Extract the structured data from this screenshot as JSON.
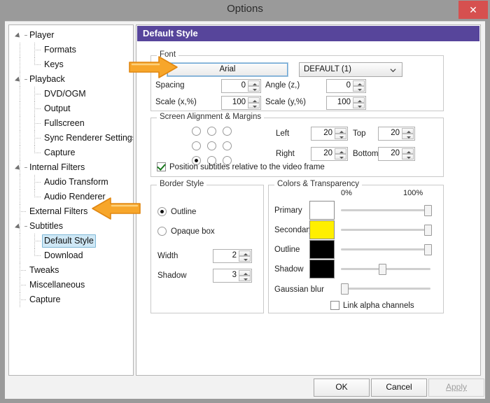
{
  "window": {
    "title": "Options",
    "close_icon": "close-icon"
  },
  "sidebar": {
    "items": [
      {
        "label": "Player",
        "level": 0,
        "expandable": true,
        "selected": false
      },
      {
        "label": "Formats",
        "level": 1,
        "expandable": false,
        "selected": false
      },
      {
        "label": "Keys",
        "level": 1,
        "expandable": false,
        "selected": false
      },
      {
        "label": "Playback",
        "level": 0,
        "expandable": true,
        "selected": false
      },
      {
        "label": "DVD/OGM",
        "level": 1,
        "expandable": false,
        "selected": false
      },
      {
        "label": "Output",
        "level": 1,
        "expandable": false,
        "selected": false
      },
      {
        "label": "Fullscreen",
        "level": 1,
        "expandable": false,
        "selected": false
      },
      {
        "label": "Sync Renderer Settings",
        "level": 1,
        "expandable": false,
        "selected": false
      },
      {
        "label": "Capture",
        "level": 1,
        "expandable": false,
        "selected": false
      },
      {
        "label": "Internal Filters",
        "level": 0,
        "expandable": true,
        "selected": false
      },
      {
        "label": "Audio Transform",
        "level": 1,
        "expandable": false,
        "selected": false
      },
      {
        "label": "Audio Renderer",
        "level": 1,
        "expandable": false,
        "selected": false
      },
      {
        "label": "External Filters",
        "level": 0,
        "expandable": false,
        "selected": false
      },
      {
        "label": "Subtitles",
        "level": 0,
        "expandable": true,
        "selected": false
      },
      {
        "label": "Default Style",
        "level": 1,
        "expandable": false,
        "selected": true
      },
      {
        "label": "Download",
        "level": 1,
        "expandable": false,
        "selected": false
      },
      {
        "label": "Tweaks",
        "level": 0,
        "expandable": false,
        "selected": false
      },
      {
        "label": "Miscellaneous",
        "level": 0,
        "expandable": false,
        "selected": false
      },
      {
        "label": "Capture",
        "level": 0,
        "expandable": false,
        "selected": false
      }
    ]
  },
  "page": {
    "header": "Default Style",
    "header_color": "#57459b"
  },
  "font_group": {
    "caption": "Font",
    "font_button": "Arial",
    "charset_value": "DEFAULT (1)",
    "chevron_icon": "chevron-down-icon",
    "spacing_label": "Spacing",
    "spacing_value": "0",
    "angle_label": "Angle (z,)",
    "angle_value": "0",
    "scale_x_label": "Scale (x,%)",
    "scale_x_value": "100",
    "scale_y_label": "Scale (y,%)",
    "scale_y_value": "100"
  },
  "align_group": {
    "caption": "Screen Alignment & Margins",
    "selected_cell": 7,
    "left_label": "Left",
    "left_value": "20",
    "top_label": "Top",
    "top_value": "20",
    "right_label": "Right",
    "right_value": "20",
    "bottom_label": "Bottom",
    "bottom_value": "20",
    "relative_checkbox_label": "Position subtitles relative to the video frame",
    "relative_checked": true
  },
  "border_group": {
    "caption": "Border Style",
    "outline_label": "Outline",
    "opaque_label": "Opaque box",
    "selected": "Outline",
    "width_label": "Width",
    "width_value": "2",
    "shadow_label": "Shadow",
    "shadow_value": "3"
  },
  "colors_group": {
    "caption": "Colors & Transparency",
    "scale_min": "0%",
    "scale_max": "100%",
    "rows": [
      {
        "label": "Primary",
        "color": "#ffffff",
        "alpha": 100
      },
      {
        "label": "Secondary",
        "color": "#ffef00",
        "alpha": 100
      },
      {
        "label": "Outline",
        "color": "#000000",
        "alpha": 100
      },
      {
        "label": "Shadow",
        "color": "#000000",
        "alpha": 45
      }
    ],
    "blur_label": "Gaussian blur",
    "blur_value": 0,
    "link_alpha_label": "Link alpha channels",
    "link_alpha_checked": false
  },
  "footer": {
    "ok_label": "OK",
    "cancel_label": "Cancel",
    "apply_label": "Apply",
    "apply_enabled": false
  },
  "annotations": {
    "arrow_color": "#f5a623",
    "arrow_font_target": "font-button",
    "arrow_tree_target": "default-style-tree-item"
  }
}
